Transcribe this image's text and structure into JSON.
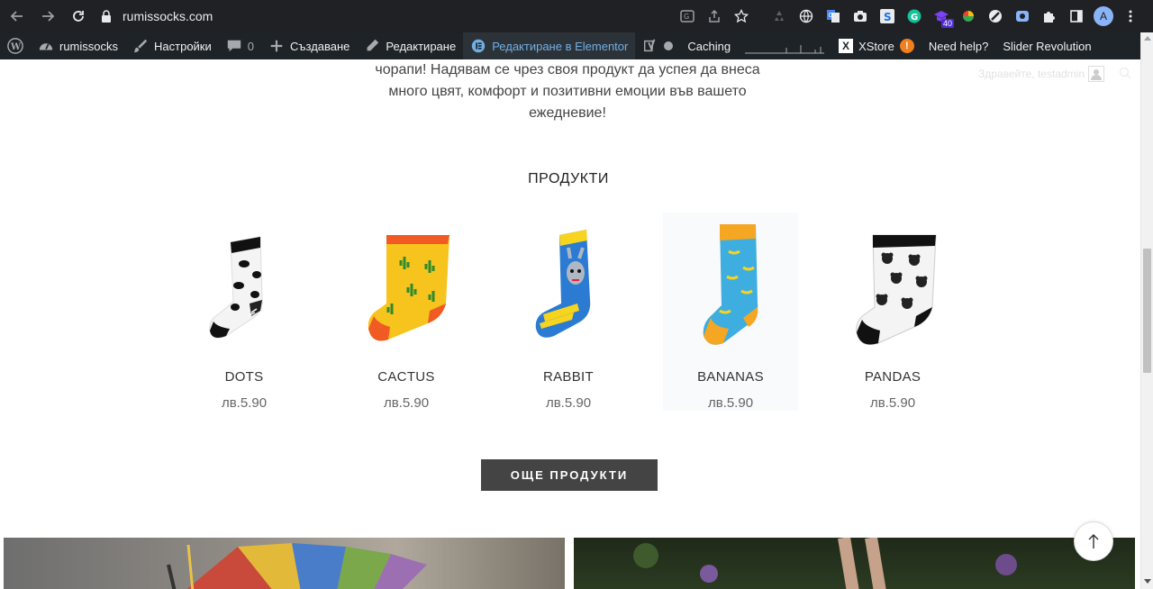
{
  "browser": {
    "url": "rumissocks.com",
    "extension_badge": "40",
    "profile_initial": "A"
  },
  "adminbar": {
    "site_name": "rumissocks",
    "settings": "Настройки",
    "comments_count": "0",
    "create": "Създаване",
    "edit": "Редактиране",
    "edit_elementor": "Редактиране в Elementor",
    "caching": "Caching",
    "xstore": "XStore",
    "xstore_badge": "!",
    "help": "Need help?",
    "slider": "Slider Revolution"
  },
  "header": {
    "greeting": "Здравейте, testadmin"
  },
  "intro": {
    "line1": "чорапи! Надявам се чрез своя продукт да успея да внеса",
    "line2": "много цвят, комфорт и позитивни емоции във вашето",
    "line3": "ежедневие!"
  },
  "products_section": {
    "title": "ПРОДУКТИ",
    "items": [
      {
        "name": "DOTS",
        "price": "лв.5.90"
      },
      {
        "name": "CACTUS",
        "price": "лв.5.90"
      },
      {
        "name": "RABBIT",
        "price": "лв.5.90"
      },
      {
        "name": "BANANAS",
        "price": "лв.5.90"
      },
      {
        "name": "PANDAS",
        "price": "лв.5.90"
      }
    ],
    "more_button": "ОЩЕ ПРОДУКТИ"
  },
  "colors": {
    "adminbar_bg": "#1d2327",
    "chrome_bg": "#202124",
    "elementor_active": "#72aee6",
    "button_bg": "#444444"
  }
}
